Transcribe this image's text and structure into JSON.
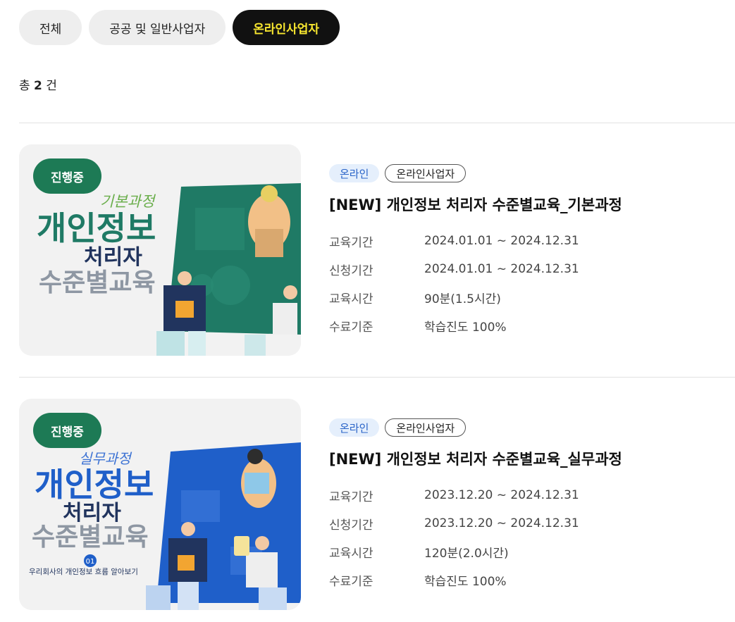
{
  "filters": [
    {
      "label": "전체",
      "active": false
    },
    {
      "label": "공공 및 일반사업자",
      "active": false
    },
    {
      "label": "온라인사업자",
      "active": true
    }
  ],
  "count": {
    "prefix": "총",
    "value": "2",
    "suffix": "건"
  },
  "courses": [
    {
      "status": "진행중",
      "tags": [
        "온라인",
        "온라인사업자"
      ],
      "title": "[NEW] 개인정보 처리자 수준별교육_기본과정",
      "thumbnail": {
        "theme": "green",
        "script_text": "기본과정",
        "line1": "개인정보",
        "line2": "처리자",
        "line3": "수준별교육",
        "caption": ""
      },
      "details": [
        {
          "label": "교육기간",
          "value": "2024.01.01 ~ 2024.12.31"
        },
        {
          "label": "신청기간",
          "value": "2024.01.01 ~ 2024.12.31"
        },
        {
          "label": "교육시간",
          "value": "90분(1.5시간)"
        },
        {
          "label": "수료기준",
          "value": "학습진도 100%"
        }
      ]
    },
    {
      "status": "진행중",
      "tags": [
        "온라인",
        "온라인사업자"
      ],
      "title": "[NEW] 개인정보 처리자 수준별교육_실무과정",
      "thumbnail": {
        "theme": "blue",
        "script_text": "실무과정",
        "line1": "개인정보",
        "line2": "처리자",
        "line3": "수준별교육",
        "badge": "01",
        "caption": "우리회사의 개인정보 흐름 알아보기"
      },
      "details": [
        {
          "label": "교육기간",
          "value": "2023.12.20 ~ 2024.12.31"
        },
        {
          "label": "신청기간",
          "value": "2023.12.20 ~ 2024.12.31"
        },
        {
          "label": "교육시간",
          "value": "120분(2.0시간)"
        },
        {
          "label": "수료기준",
          "value": "학습진도 100%"
        }
      ]
    }
  ],
  "colors": {
    "active_filter_bg": "#111111",
    "active_filter_text": "#f7e62f",
    "status_badge": "#1d7a55",
    "tag_blue_bg": "#e5effc",
    "tag_blue_text": "#2a64c8",
    "thumb_green": "#1f7a65",
    "thumb_blue": "#1f5fc9"
  }
}
